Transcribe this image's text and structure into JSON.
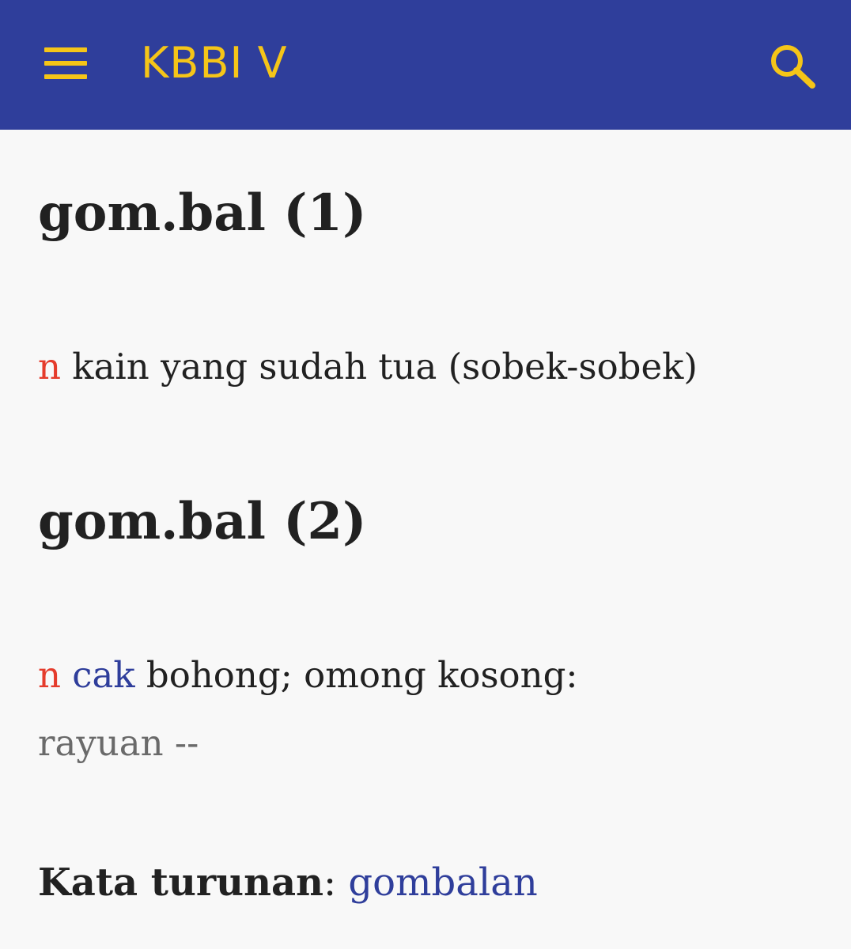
{
  "appbar": {
    "title": "KBBI V",
    "menu_icon": "menu-icon",
    "search_icon": "search-icon",
    "background_color": "#2f3e9b",
    "accent_color": "#f5c518"
  },
  "entries": [
    {
      "headword": "gom.bal (1)",
      "pos": "n",
      "definition": "kain yang sudah tua (sobek-sobek)"
    },
    {
      "headword": "gom.bal (2)",
      "pos": "n",
      "label": "cak",
      "definition": "bohong; omong kosong:",
      "example": "rayuan --"
    }
  ],
  "derived": {
    "label": "Kata turunan",
    "separator": ":",
    "word": "gombalan"
  },
  "colors": {
    "pos": "#e53c2c",
    "label_link": "#2f3e9b",
    "example": "#6a6a6a",
    "text": "#212121",
    "background": "#f8f8f8"
  }
}
